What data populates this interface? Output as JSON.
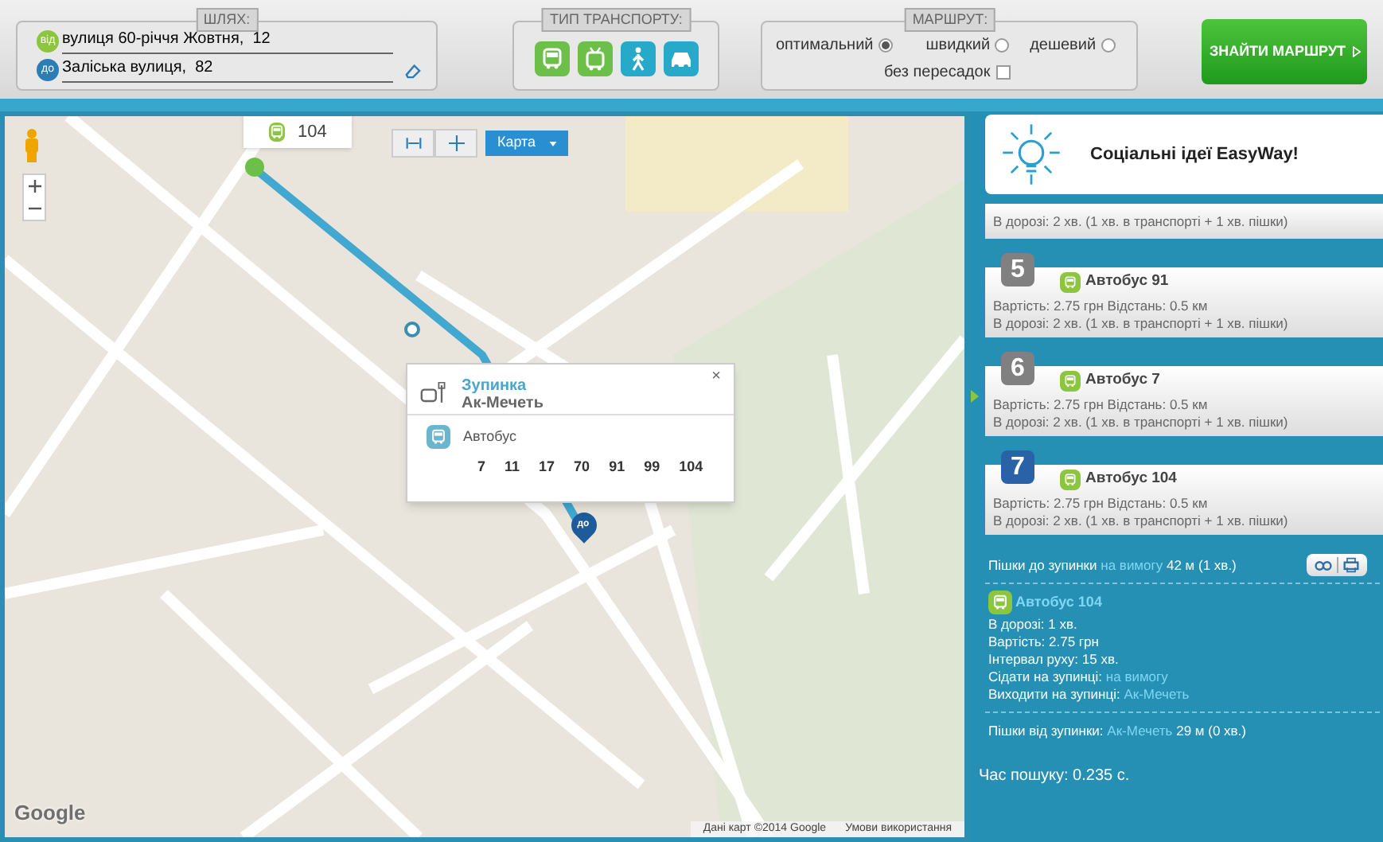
{
  "search": {
    "title": "ШЛЯХ:",
    "from": {
      "badge": "від",
      "value": "вулиця 60-річчя Жовтня,  12"
    },
    "to": {
      "badge": "до",
      "value": "Заліська вулиця,  82"
    }
  },
  "transport": {
    "title": "ТИП ТРАНСПОРТУ:",
    "modes": [
      {
        "kind": "bus"
      },
      {
        "kind": "trolley"
      },
      {
        "kind": "walk"
      },
      {
        "kind": "car"
      }
    ]
  },
  "route_options": {
    "title": "МАРШРУТ:",
    "options": [
      {
        "label": "оптимальний",
        "selected": true
      },
      {
        "label": "швидкий",
        "selected": false
      },
      {
        "label": "дешевий",
        "selected": false
      }
    ],
    "no_transfers": {
      "label": "без пересадок",
      "checked": false
    }
  },
  "find_button": "ЗНАЙТИ МАРШРУТ",
  "map": {
    "map_type": "Карта",
    "route_label": "104",
    "marker": "до",
    "stop_popup": {
      "title": "Зупинка",
      "name": "Ак-Мечеть",
      "close": "×",
      "transport": "Автобус",
      "routes": [
        "7",
        "11",
        "17",
        "70",
        "91",
        "99",
        "104"
      ]
    },
    "logo": "Google",
    "attribution": "Дані карт ©2014 Google",
    "terms": "Умови використання"
  },
  "promo": {
    "title": "Соціальні ідеї EasyWay!"
  },
  "results": [
    {
      "kind": "partial",
      "trip": "В дорозі: 2 хв. (1 хв. в транспорті + 1 хв. пішки)"
    },
    {
      "kind": "full",
      "number": "5",
      "selected": false,
      "title": "Автобус 91",
      "cost": "Вартість: 2.75 грн Відстань: 0.5 км",
      "trip": "В дорозі: 2 хв. (1 хв. в транспорті + 1 хв. пішки)"
    },
    {
      "kind": "full",
      "number": "6",
      "selected": false,
      "title": "Автобус 7",
      "cost": "Вартість: 2.75 грн Відстань: 0.5 км",
      "trip": "В дорозі: 2 хв. (1 хв. в транспорті + 1 хв. пішки)"
    },
    {
      "kind": "full",
      "number": "7",
      "selected": true,
      "title": "Автобус 104",
      "cost": "Вартість: 2.75 грн Відстань: 0.5 км",
      "trip": "В дорозі: 2 хв. (1 хв. в транспорті + 1 хв. пішки)"
    }
  ],
  "details": {
    "walk_to": {
      "label": "Пішки до зупинки",
      "link": "на вимогу",
      "rest": "42 м (1 хв.)"
    },
    "leg": {
      "title": "Автобус 104",
      "lines": [
        {
          "label": "В дорозі:",
          "value": "1 хв.",
          "link": false
        },
        {
          "label": "Вартість:",
          "value": "2.75 грн",
          "link": false
        },
        {
          "label": "Інтервал руху:",
          "value": "15 хв.",
          "link": false
        },
        {
          "label": "Сідати на зупинці:",
          "value": "на вимогу",
          "link": true
        },
        {
          "label": "Виходити на зупинці:",
          "value": "Ак-Мечеть",
          "link": true
        }
      ]
    },
    "walk_from": {
      "label": "Пішки від зупинки:",
      "link": "Ак-Мечеть",
      "rest": "29 м (0 хв.)"
    }
  },
  "search_time": "Час пошуку: 0.235 с."
}
